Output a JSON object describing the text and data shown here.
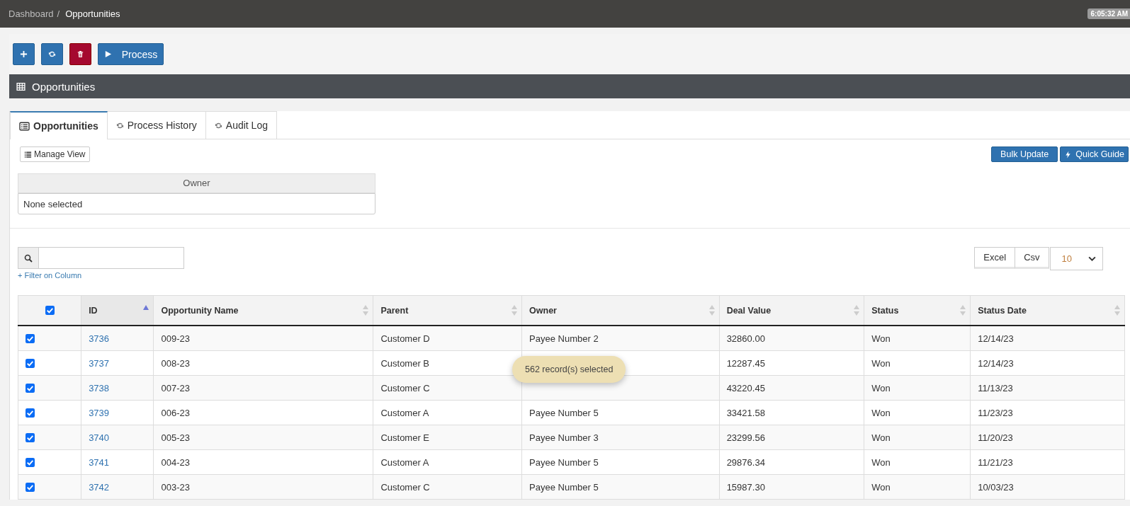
{
  "breadcrumb": {
    "separator": "/",
    "items": [
      {
        "label": "Dashboard",
        "current": false
      },
      {
        "label": "Opportunities",
        "current": true
      }
    ]
  },
  "clock": "6:05:32 AM",
  "toolbar": [
    {
      "kind": "add"
    },
    {
      "kind": "refresh"
    },
    {
      "kind": "delete"
    },
    {
      "kind": "process",
      "label": "Process"
    }
  ],
  "panel_title": "Opportunities",
  "tabs": [
    {
      "label": "Opportunities",
      "selected": true,
      "kind": "list"
    },
    {
      "label": "Process History",
      "selected": false,
      "kind": "refresh"
    },
    {
      "label": "Audit Log",
      "selected": false,
      "kind": "refresh"
    }
  ],
  "manage_view": "Manage View",
  "actions": [
    {
      "label": "Bulk Update",
      "kind": "plain"
    },
    {
      "label": "Quick Guide",
      "kind": "bolt"
    }
  ],
  "owner_filter": {
    "heading": "Owner",
    "value": "None selected"
  },
  "filter_link": "+ Filter on Column",
  "exports": [
    "Excel",
    "Csv"
  ],
  "page_size": "10",
  "table": {
    "select_all": true,
    "columns": [
      {
        "label": "ID",
        "sorted_ascending": true
      },
      {
        "label": "Opportunity Name",
        "sorted_ascending": false
      },
      {
        "label": "Parent",
        "sorted_ascending": false
      },
      {
        "label": "Owner",
        "sorted_ascending": false
      },
      {
        "label": "Deal Value",
        "sorted_ascending": false
      },
      {
        "label": "Status",
        "sorted_ascending": false
      },
      {
        "label": "Status Date",
        "sorted_ascending": false
      }
    ],
    "rows": [
      {
        "selected": true,
        "cells": [
          "3736",
          "009-23",
          "Customer D",
          "Payee Number 2",
          "32860.00",
          "Won",
          "12/14/23"
        ]
      },
      {
        "selected": true,
        "cells": [
          "3737",
          "008-23",
          "Customer B",
          "",
          "12287.45",
          "Won",
          "12/14/23"
        ]
      },
      {
        "selected": true,
        "cells": [
          "3738",
          "007-23",
          "Customer C",
          "",
          "43220.45",
          "Won",
          "11/13/23"
        ]
      },
      {
        "selected": true,
        "cells": [
          "3739",
          "006-23",
          "Customer A",
          "Payee Number 5",
          "33421.58",
          "Won",
          "11/23/23"
        ]
      },
      {
        "selected": true,
        "cells": [
          "3740",
          "005-23",
          "Customer E",
          "Payee Number 3",
          "23299.56",
          "Won",
          "11/20/23"
        ]
      },
      {
        "selected": true,
        "cells": [
          "3741",
          "004-23",
          "Customer A",
          "Payee Number 5",
          "29876.34",
          "Won",
          "11/21/23"
        ]
      },
      {
        "selected": true,
        "cells": [
          "3742",
          "003-23",
          "Customer C",
          "Payee Number 5",
          "15987.30",
          "Won",
          "10/03/23"
        ]
      }
    ]
  },
  "toast": "562 record(s) selected"
}
